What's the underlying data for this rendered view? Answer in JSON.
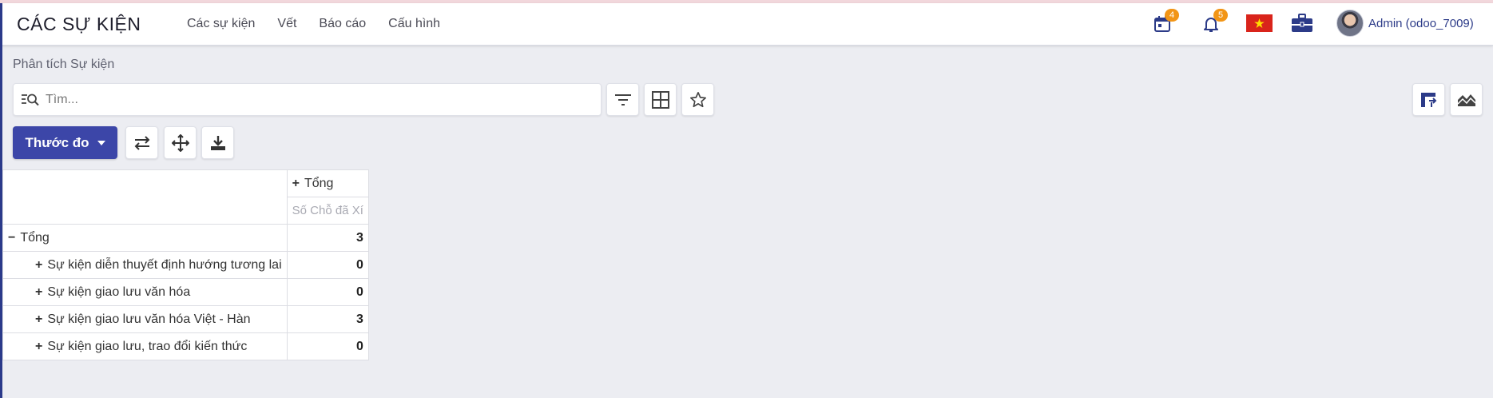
{
  "navbar": {
    "app_title": "CÁC SỰ KIỆN",
    "menu": [
      "Các sự kiện",
      "Vết",
      "Báo cáo",
      "Cấu hình"
    ],
    "calendar_badge": "4",
    "bell_badge": "5",
    "user_name": "Admin (odoo_7009)"
  },
  "breadcrumb": "Phân tích Sự kiện",
  "search": {
    "placeholder": "Tìm..."
  },
  "toolbar": {
    "measures_label": "Thước đo"
  },
  "pivot": {
    "col_header": "Tổng",
    "measure_header": "Số Chỗ đã Xí",
    "total_label": "Tổng",
    "total_value": "3",
    "rows": [
      {
        "label": "Sự kiện diễn thuyết định hướng tương lai",
        "value": "0"
      },
      {
        "label": "Sự kiện giao lưu văn hóa",
        "value": "0"
      },
      {
        "label": "Sự kiện giao lưu văn hóa Việt - Hàn",
        "value": "3"
      },
      {
        "label": "Sự kiện giao lưu, trao đổi kiến thức",
        "value": "0"
      }
    ]
  },
  "colors": {
    "accent": "#3c46a8",
    "badge": "#f29516",
    "user_text": "#2c3b88"
  },
  "icons": [
    "calendar-icon",
    "bell-icon",
    "vietnam-flag-icon",
    "briefcase-icon",
    "filter-icon",
    "grid-icon",
    "star-icon",
    "flip-axis-icon",
    "expand-icon",
    "download-icon",
    "pivot-view-icon",
    "graph-view-icon"
  ]
}
